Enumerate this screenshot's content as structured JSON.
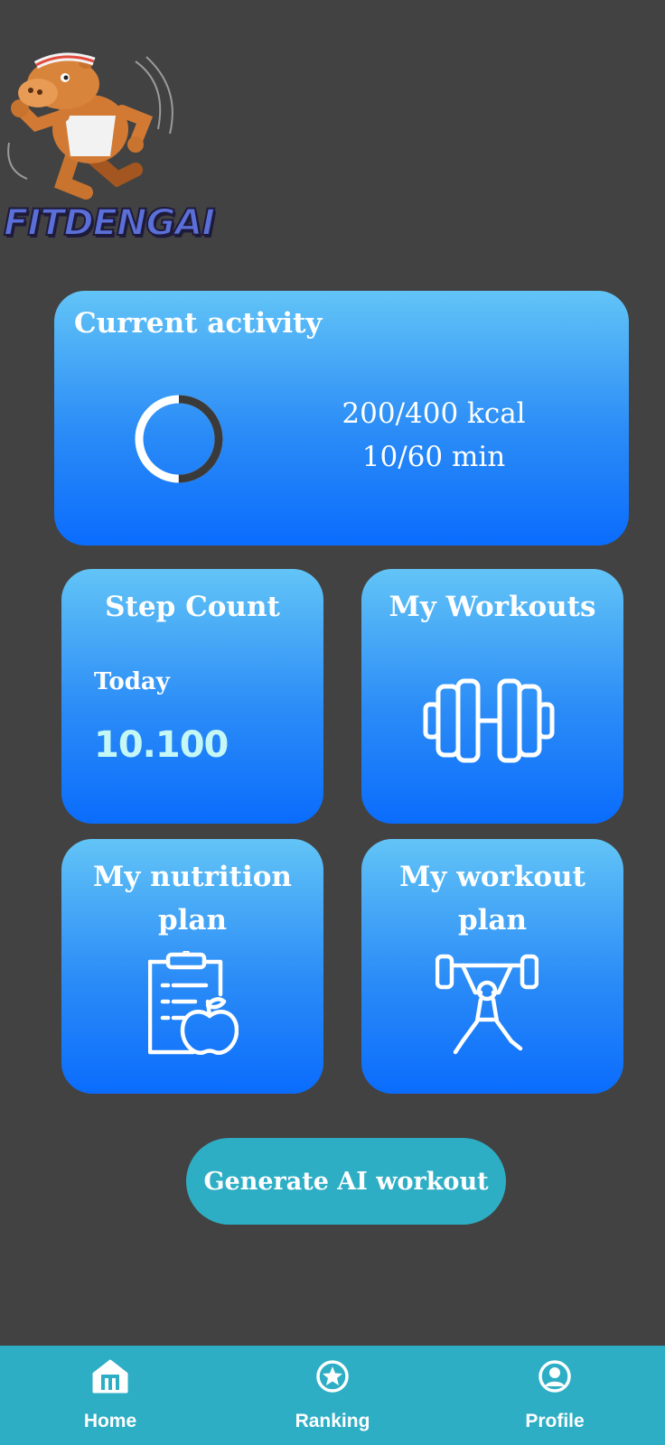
{
  "logo": {
    "text": "FITDENGAI"
  },
  "activity": {
    "title": "Current activity",
    "progress": 0.5,
    "kcal": "200/400 kcal",
    "minutes": "10/60 min"
  },
  "cards": {
    "steps": {
      "title": "Step Count",
      "today_label": "Today",
      "value": "10.100"
    },
    "workouts": {
      "title": "My Workouts",
      "icon": "dumbbell-icon"
    },
    "nutrition": {
      "title_line1": "My nutrition",
      "title_line2": "plan",
      "icon": "clipboard-apple-icon"
    },
    "workout_plan": {
      "title_line1": "My workout",
      "title_line2": "plan",
      "icon": "weightlifter-icon"
    }
  },
  "generate_button": {
    "label": "Generate AI workout"
  },
  "nav": {
    "items": [
      {
        "label": "Home",
        "icon": "home-icon"
      },
      {
        "label": "Ranking",
        "icon": "star-icon"
      },
      {
        "label": "Profile",
        "icon": "user-circle-icon"
      }
    ]
  },
  "colors": {
    "background": "#424242",
    "card_top": "#62c4f6",
    "card_bottom": "#0a6cfc",
    "accent": "#2eaec5",
    "step_value": "#c4f7f6"
  }
}
